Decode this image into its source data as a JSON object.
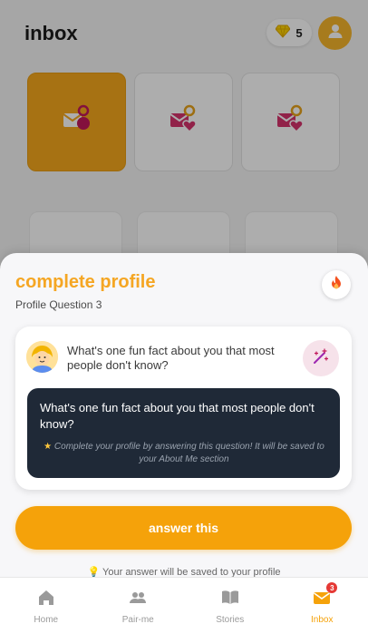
{
  "header": {
    "title": "inbox",
    "gems": "5"
  },
  "sheet": {
    "title": "complete profile",
    "subtitle": "Profile Question 3",
    "question": "What's one fun fact about you that most people don't know?",
    "dark_question": "What's one fun fact about you that most people don't know?",
    "dark_note": "Complete your profile by answering this question! It will be saved to your  About Me section",
    "answer_label": "answer this",
    "save_hint": "Your answer will be saved to your profile"
  },
  "nav": {
    "items": [
      {
        "label": "Home",
        "icon": "home-icon"
      },
      {
        "label": "Pair-me",
        "icon": "users-icon"
      },
      {
        "label": "Stories",
        "icon": "book-icon"
      },
      {
        "label": "Inbox",
        "icon": "mail-icon",
        "badge": "3"
      }
    ]
  },
  "colors": {
    "accent": "#f5a20a",
    "title": "#f5a623",
    "dark": "#1f2937",
    "pink": "#d6336c"
  }
}
